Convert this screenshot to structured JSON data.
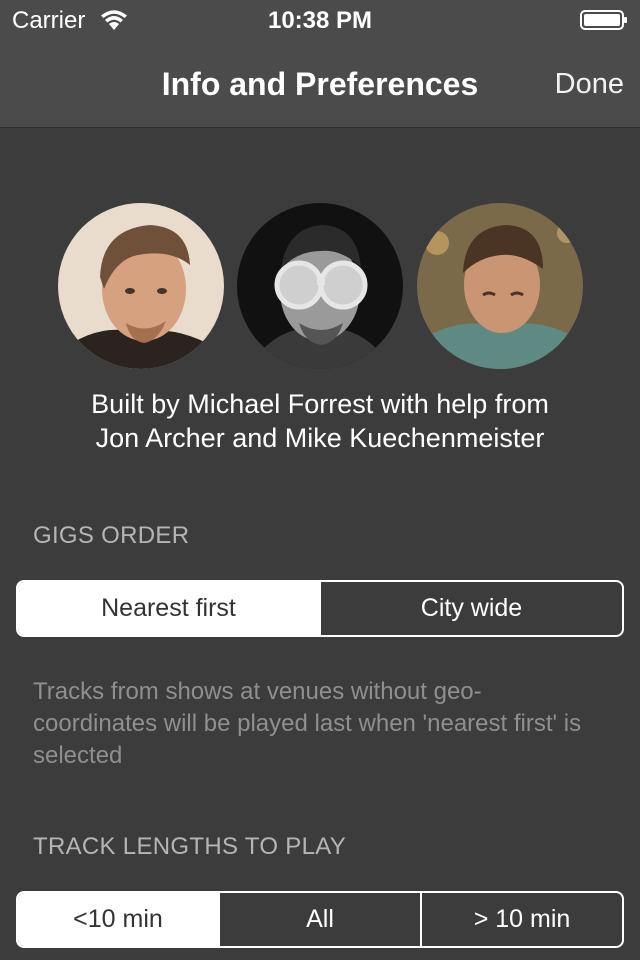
{
  "status_bar": {
    "carrier": "Carrier",
    "time": "10:38 PM",
    "wifi_icon": "wifi-icon",
    "battery_icon": "battery-icon"
  },
  "nav": {
    "title": "Info and Preferences",
    "done_label": "Done"
  },
  "credits": {
    "line1": "Built by Michael Forrest with help from",
    "line2": "Jon Archer and Mike Kuechenmeister"
  },
  "gigs_order": {
    "header": "GIGS ORDER",
    "options": [
      "Nearest first",
      "City wide"
    ],
    "selected": "Nearest first",
    "footnote": "Tracks from shows at venues without geo-coordinates will be played last when 'nearest first' is selected"
  },
  "track_lengths": {
    "header": "TRACK LENGTHS TO PLAY",
    "options": [
      "<10 min",
      "All",
      "> 10 min"
    ],
    "selected": "<10 min"
  },
  "colors": {
    "background": "#3c3c3c",
    "bar": "#4b4b4b",
    "section_header": "#b5b5b5",
    "footnote": "#8f8f8f",
    "segment_selected_bg": "#ffffff",
    "segment_selected_text": "#333333"
  }
}
